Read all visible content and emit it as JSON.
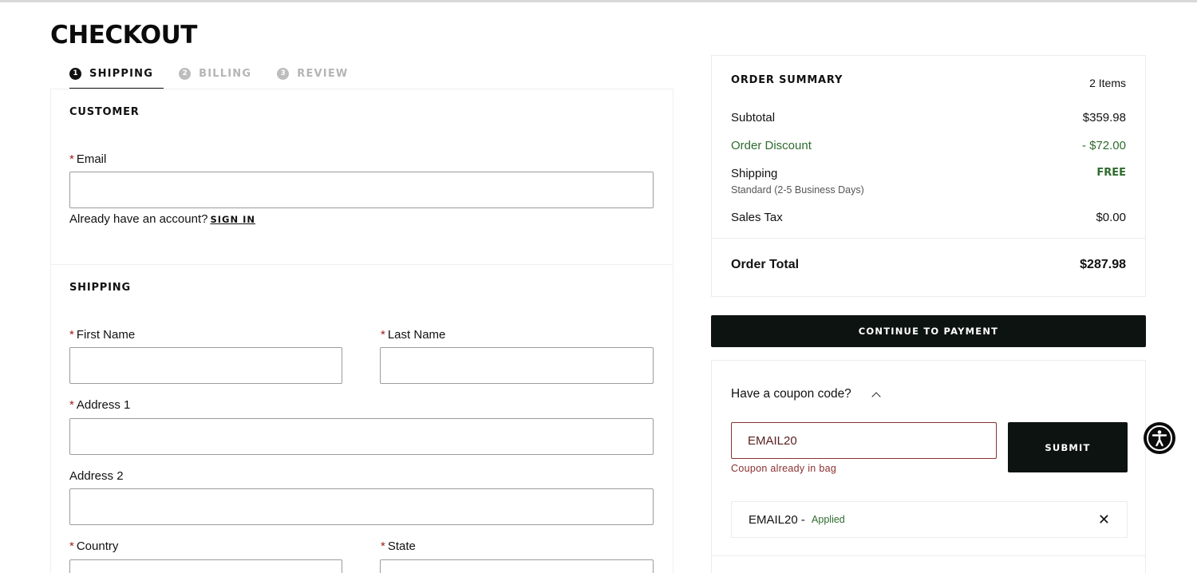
{
  "page": {
    "title": "CHECKOUT"
  },
  "steps": [
    {
      "num": "1",
      "label": "SHIPPING"
    },
    {
      "num": "2",
      "label": "BILLING"
    },
    {
      "num": "3",
      "label": "REVIEW"
    }
  ],
  "customer": {
    "title": "CUSTOMER",
    "email_required": "*",
    "email_label": "Email",
    "email_value": "",
    "account_prompt": "Already have an account?",
    "sign_in": "SIGN IN"
  },
  "shipping": {
    "title": "SHIPPING",
    "first_name_label": "First Name",
    "last_name_label": "Last Name",
    "address1_label": "Address 1",
    "address2_label": "Address 2",
    "country_label": "Country",
    "state_label": "State",
    "required_mark": "*"
  },
  "summary": {
    "title": "ORDER SUMMARY",
    "item_count": "2 Items",
    "subtotal_label": "Subtotal",
    "subtotal_value": "$359.98",
    "discount_label": "Order Discount",
    "discount_value": "- $72.00",
    "shipping_label": "Shipping",
    "shipping_value": "FREE",
    "shipping_method": "Standard (2-5 Business Days)",
    "tax_label": "Sales Tax",
    "tax_value": "$0.00",
    "total_label": "Order Total",
    "total_value": "$287.98"
  },
  "continue_label": "CONTINUE TO PAYMENT",
  "coupon": {
    "heading": "Have a coupon code?",
    "input_value": "EMAIL20",
    "error": "Coupon already in bag",
    "submit_label": "SUBMIT",
    "applied_code": "EMAIL20",
    "applied_sep": " - ",
    "applied_status": "Applied",
    "remove_glyph": "✕"
  },
  "icons": {
    "accessibility": "accessibility-icon",
    "chevron": "chevron-up-icon",
    "close": "close-icon"
  },
  "colors": {
    "primary_button": "#0d1311",
    "discount_green": "#2e6b2e",
    "error_red": "#8a3030"
  }
}
